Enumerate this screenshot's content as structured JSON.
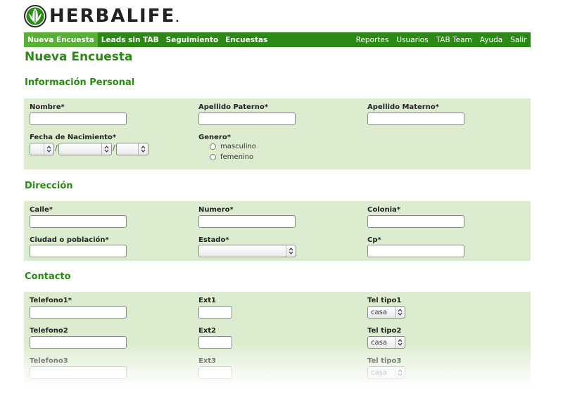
{
  "brand": {
    "name": "HERBALIFE",
    "mark": "."
  },
  "nav": {
    "left": [
      "Nueva Encuesta",
      "Leads sin TAB",
      "Seguimiento",
      "Encuestas"
    ],
    "right": [
      "Reportes",
      "Usuarios",
      "TAB Team",
      "Ayuda",
      "Salir"
    ],
    "active": "Nueva Encuesta"
  },
  "page_title": "Nueva Encuesta",
  "personal": {
    "title": "Información Personal",
    "nombre": "Nombre*",
    "apellido_paterno": "Apellido Paterno*",
    "apellido_materno": "Apellido Materno*",
    "fecha_nacimiento": "Fecha de Nacimiento*",
    "date_separator": "/",
    "genero": "Genero*",
    "genero_options": [
      "masculino",
      "femenino"
    ]
  },
  "direccion": {
    "title": "Dirección",
    "calle": "Calle*",
    "numero": "Numero*",
    "colonia": "Colonia*",
    "ciudad": "Ciudad o población*",
    "estado": "Estado*",
    "cp": "Cp*"
  },
  "contacto": {
    "title": "Contacto",
    "telefono1": "Telefono1*",
    "ext1": "Ext1",
    "tel_tipo1": "Tel tipo1",
    "tel_tipo1_value": "casa",
    "telefono2": "Telefono2",
    "ext2": "Ext2",
    "tel_tipo2": "Tel tipo2",
    "tel_tipo2_value": "casa",
    "telefono3": "Telefono3",
    "ext3": "Ext3",
    "tel_tipo3": "Tel tipo3",
    "tel_tipo3_value": "casa"
  },
  "colors": {
    "brand_green": "#2a8a14",
    "active_tab": "#56b134",
    "panel_bg": "#dcedcf"
  },
  "icons": {
    "logo": "herbalife-leaf-logo",
    "select_arrow": "updown-arrows-icon"
  }
}
